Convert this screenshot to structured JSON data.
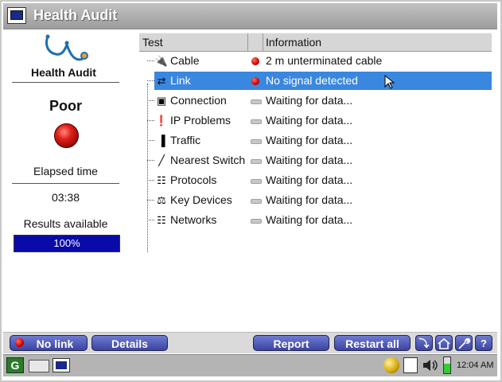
{
  "window": {
    "title": "Health Audit"
  },
  "left_panel": {
    "title": "Health Audit",
    "status": "Poor",
    "elapsed_label": "Elapsed time",
    "elapsed_value": "03:38",
    "results_label": "Results available",
    "progress_text": "100%",
    "progress_fraction": 1.0
  },
  "table": {
    "columns": {
      "test": "Test",
      "information": "Information"
    },
    "rows": [
      {
        "name": "Cable",
        "icon": "cable-icon",
        "status": "red",
        "info": "2 m unterminated cable"
      },
      {
        "name": "Link",
        "icon": "link-icon",
        "status": "red",
        "info": "No signal detected",
        "selected": true
      },
      {
        "name": "Connection",
        "icon": "connection-icon",
        "status": "waiting",
        "info": "Waiting for data..."
      },
      {
        "name": "IP Problems",
        "icon": "ip-problems-icon",
        "status": "waiting",
        "info": "Waiting for data..."
      },
      {
        "name": "Traffic",
        "icon": "traffic-icon",
        "status": "waiting",
        "info": "Waiting for data..."
      },
      {
        "name": "Nearest Switch",
        "icon": "switch-icon",
        "status": "waiting",
        "info": "Waiting for data..."
      },
      {
        "name": "Protocols",
        "icon": "protocols-icon",
        "status": "waiting",
        "info": "Waiting for data..."
      },
      {
        "name": "Key Devices",
        "icon": "key-devices-icon",
        "status": "waiting",
        "info": "Waiting for data..."
      },
      {
        "name": "Networks",
        "icon": "networks-icon",
        "status": "waiting",
        "info": "Waiting for data..."
      }
    ]
  },
  "buttons": {
    "no_link": "No link",
    "details": "Details",
    "report": "Report",
    "restart_all": "Restart all",
    "help": "?"
  },
  "taskbar": {
    "clock": "12:04 AM"
  },
  "colors": {
    "selection": "#3a87e0",
    "button": "#4b55b5",
    "progress": "#0a0aa8",
    "alert": "#d00000"
  }
}
